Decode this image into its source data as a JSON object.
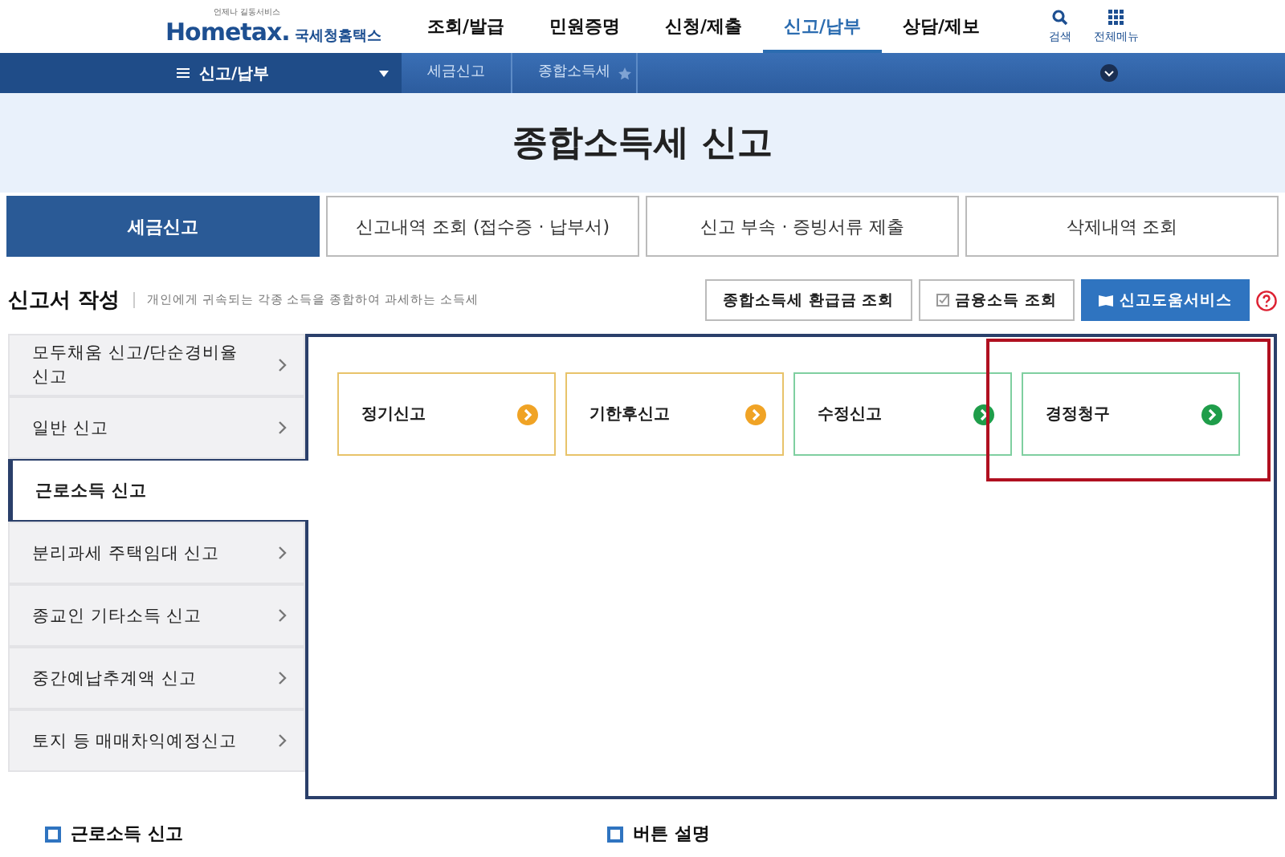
{
  "logo": {
    "tagline": "언제나 길동서비스",
    "brand": "Hometax.",
    "name": "국세청홈택스"
  },
  "menu": [
    {
      "label": "조회/발급",
      "selected": false
    },
    {
      "label": "민원증명",
      "selected": false
    },
    {
      "label": "신청/제출",
      "selected": false
    },
    {
      "label": "신고/납부",
      "selected": true
    },
    {
      "label": "상담/제보",
      "selected": false
    }
  ],
  "utilities": [
    {
      "label": "검색",
      "kind": "search"
    },
    {
      "label": "전체메뉴",
      "kind": "grid"
    }
  ],
  "breadcrumb": {
    "menu": "신고/납부",
    "path": [
      "세금신고",
      "종합소득세"
    ]
  },
  "page_title": "종합소득세 신고",
  "tabs": [
    {
      "label": "세금신고",
      "selected": true
    },
    {
      "label": "신고내역 조회 (접수증 · 납부서)",
      "selected": false
    },
    {
      "label": "신고 부속 · 증빙서류 제출",
      "selected": false
    },
    {
      "label": "삭제내역 조회",
      "selected": false
    }
  ],
  "section": {
    "title": "신고서 작성",
    "description": "개인에게 귀속되는 각종 소득을 종합하여 과세하는 소득세"
  },
  "actions": [
    {
      "label": "종합소득세 환급금 조회",
      "kind": "plain"
    },
    {
      "label": "금융소득 조회",
      "kind": "check"
    },
    {
      "label": "신고도움서비스",
      "kind": "primary"
    }
  ],
  "sidebar": [
    {
      "label": "모두채움 신고/단순경비율 신고",
      "selected": false
    },
    {
      "label": "일반 신고",
      "selected": false
    },
    {
      "label": "근로소득 신고",
      "selected": true
    },
    {
      "label": "분리과세 주택임대 신고",
      "selected": false
    },
    {
      "label": "종교인 기타소득 신고",
      "selected": false
    },
    {
      "label": "중간예납추계액 신고",
      "selected": false
    },
    {
      "label": "토지 등 매매차익예정신고",
      "selected": false
    }
  ],
  "options": [
    {
      "label": "정기신고",
      "kind": "orange",
      "highlighted": false
    },
    {
      "label": "기한후신고",
      "kind": "orange",
      "highlighted": false
    },
    {
      "label": "수정신고",
      "kind": "green",
      "highlighted": false
    },
    {
      "label": "경정청구",
      "kind": "green",
      "highlighted": true
    }
  ],
  "bottom_headings": [
    "근로소득 신고",
    "버튼 설명"
  ]
}
